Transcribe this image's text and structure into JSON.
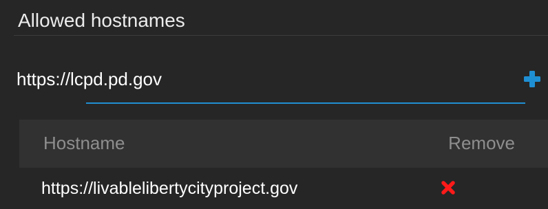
{
  "section": {
    "title": "Allowed hostnames"
  },
  "input": {
    "value": "https://lcpd.pd.gov",
    "placeholder": ""
  },
  "add_button": {
    "icon": "plus-icon",
    "color": "#1f8fd3"
  },
  "table": {
    "columns": {
      "hostname": "Hostname",
      "remove": "Remove"
    },
    "rows": [
      {
        "hostname": "https://livablelibertycityproject.gov",
        "remove_icon": "close-icon",
        "remove_color": "#ff1a1a"
      }
    ]
  },
  "colors": {
    "background": "#262626",
    "header_background": "#313131",
    "accent": "#1f8fd3",
    "danger": "#ff1a1a"
  }
}
